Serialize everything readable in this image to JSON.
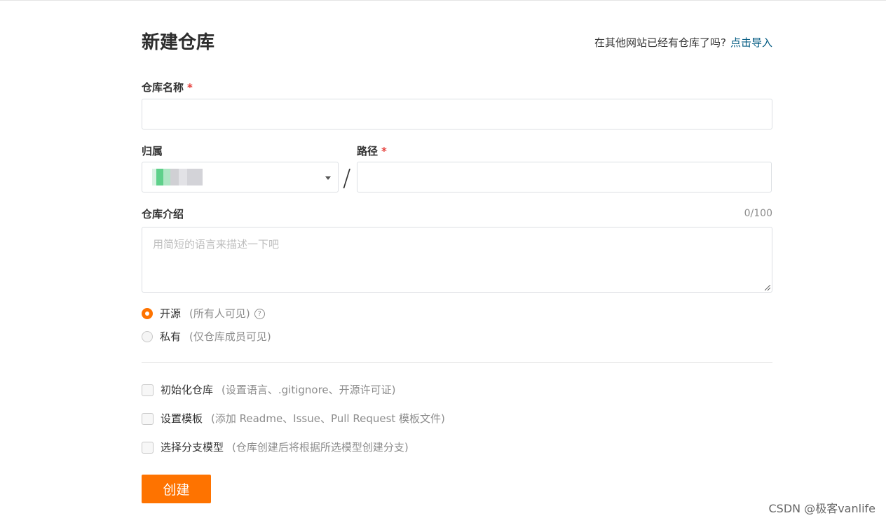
{
  "page": {
    "title": "新建仓库"
  },
  "import": {
    "question": "在其他网站已经有仓库了吗?",
    "link": "点击导入"
  },
  "repo_name": {
    "label": "仓库名称",
    "required": "*",
    "value": ""
  },
  "owner": {
    "label": "归属",
    "value": "(blurred)"
  },
  "path": {
    "label": "路径",
    "required": "*",
    "value": "",
    "separator": "/"
  },
  "description": {
    "label": "仓库介绍",
    "counter": "0/100",
    "placeholder": "用简短的语言来描述一下吧"
  },
  "visibility": {
    "options": [
      {
        "label": "开源",
        "hint": "(所有人可见)",
        "selected": true,
        "help_icon": "?"
      },
      {
        "label": "私有",
        "hint": "(仅仓库成员可见)",
        "selected": false
      }
    ]
  },
  "options": [
    {
      "label": "初始化仓库",
      "hint": "(设置语言、.gitignore、开源许可证)",
      "checked": false
    },
    {
      "label": "设置模板",
      "hint": "(添加 Readme、Issue、Pull Request 模板文件)",
      "checked": false
    },
    {
      "label": "选择分支模型",
      "hint": "(仓库创建后将根据所选模型创建分支)",
      "checked": false
    }
  ],
  "submit": {
    "label": "创建"
  },
  "watermark": "CSDN @极客vanlife",
  "colors": {
    "accent": "#fe7300",
    "link": "#005980",
    "required": "#e5403c"
  }
}
